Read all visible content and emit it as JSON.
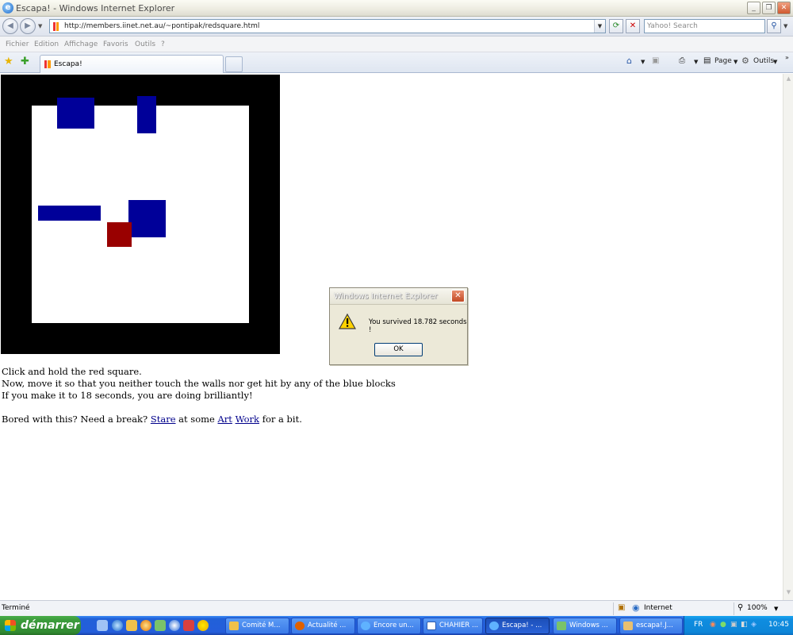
{
  "window": {
    "title": "Escapa! - Windows Internet Explorer"
  },
  "address": {
    "url": "http://members.iinet.net.au/~pontipak/redsquare.html"
  },
  "search": {
    "placeholder": "Yahoo! Search"
  },
  "menu": [
    "Fichier",
    "Edition",
    "Affichage",
    "Favoris",
    "Outils",
    "?"
  ],
  "tab": {
    "label": "Escapa!"
  },
  "commands": {
    "page": "Page",
    "tools": "Outils"
  },
  "page": {
    "line1": "Click and hold the red square.",
    "line2": "Now, move it so that you neither touch the walls nor get hit by any of the blue blocks",
    "line3": "If you make it to 18 seconds, you are doing brilliantly!",
    "bored_prefix": "Bored with this? Need a break?",
    "link_stare": "Stare",
    "at_some": "at some",
    "link_art": "Art",
    "link_work": "Work",
    "for_a_bit": "for a bit."
  },
  "dialog": {
    "title": "Windows Internet Explorer",
    "message": "You survived 18.782 seconds !",
    "ok_label": "OK"
  },
  "status": {
    "text": "Terminé",
    "zone": "Internet",
    "zoom": "100%"
  },
  "taskbar": {
    "start_label": "démarrer",
    "buttons": [
      "Comité M...",
      "Actualité ...",
      "Encore un...",
      "CHAHIER ...",
      "Escapa! - ...",
      "Windows ...",
      "escapa!.J..."
    ],
    "tray_lang": "FR",
    "clock": "10:45"
  },
  "colors": {
    "wall": "#000000",
    "blue_block": "#000099",
    "red_square": "#990000"
  }
}
